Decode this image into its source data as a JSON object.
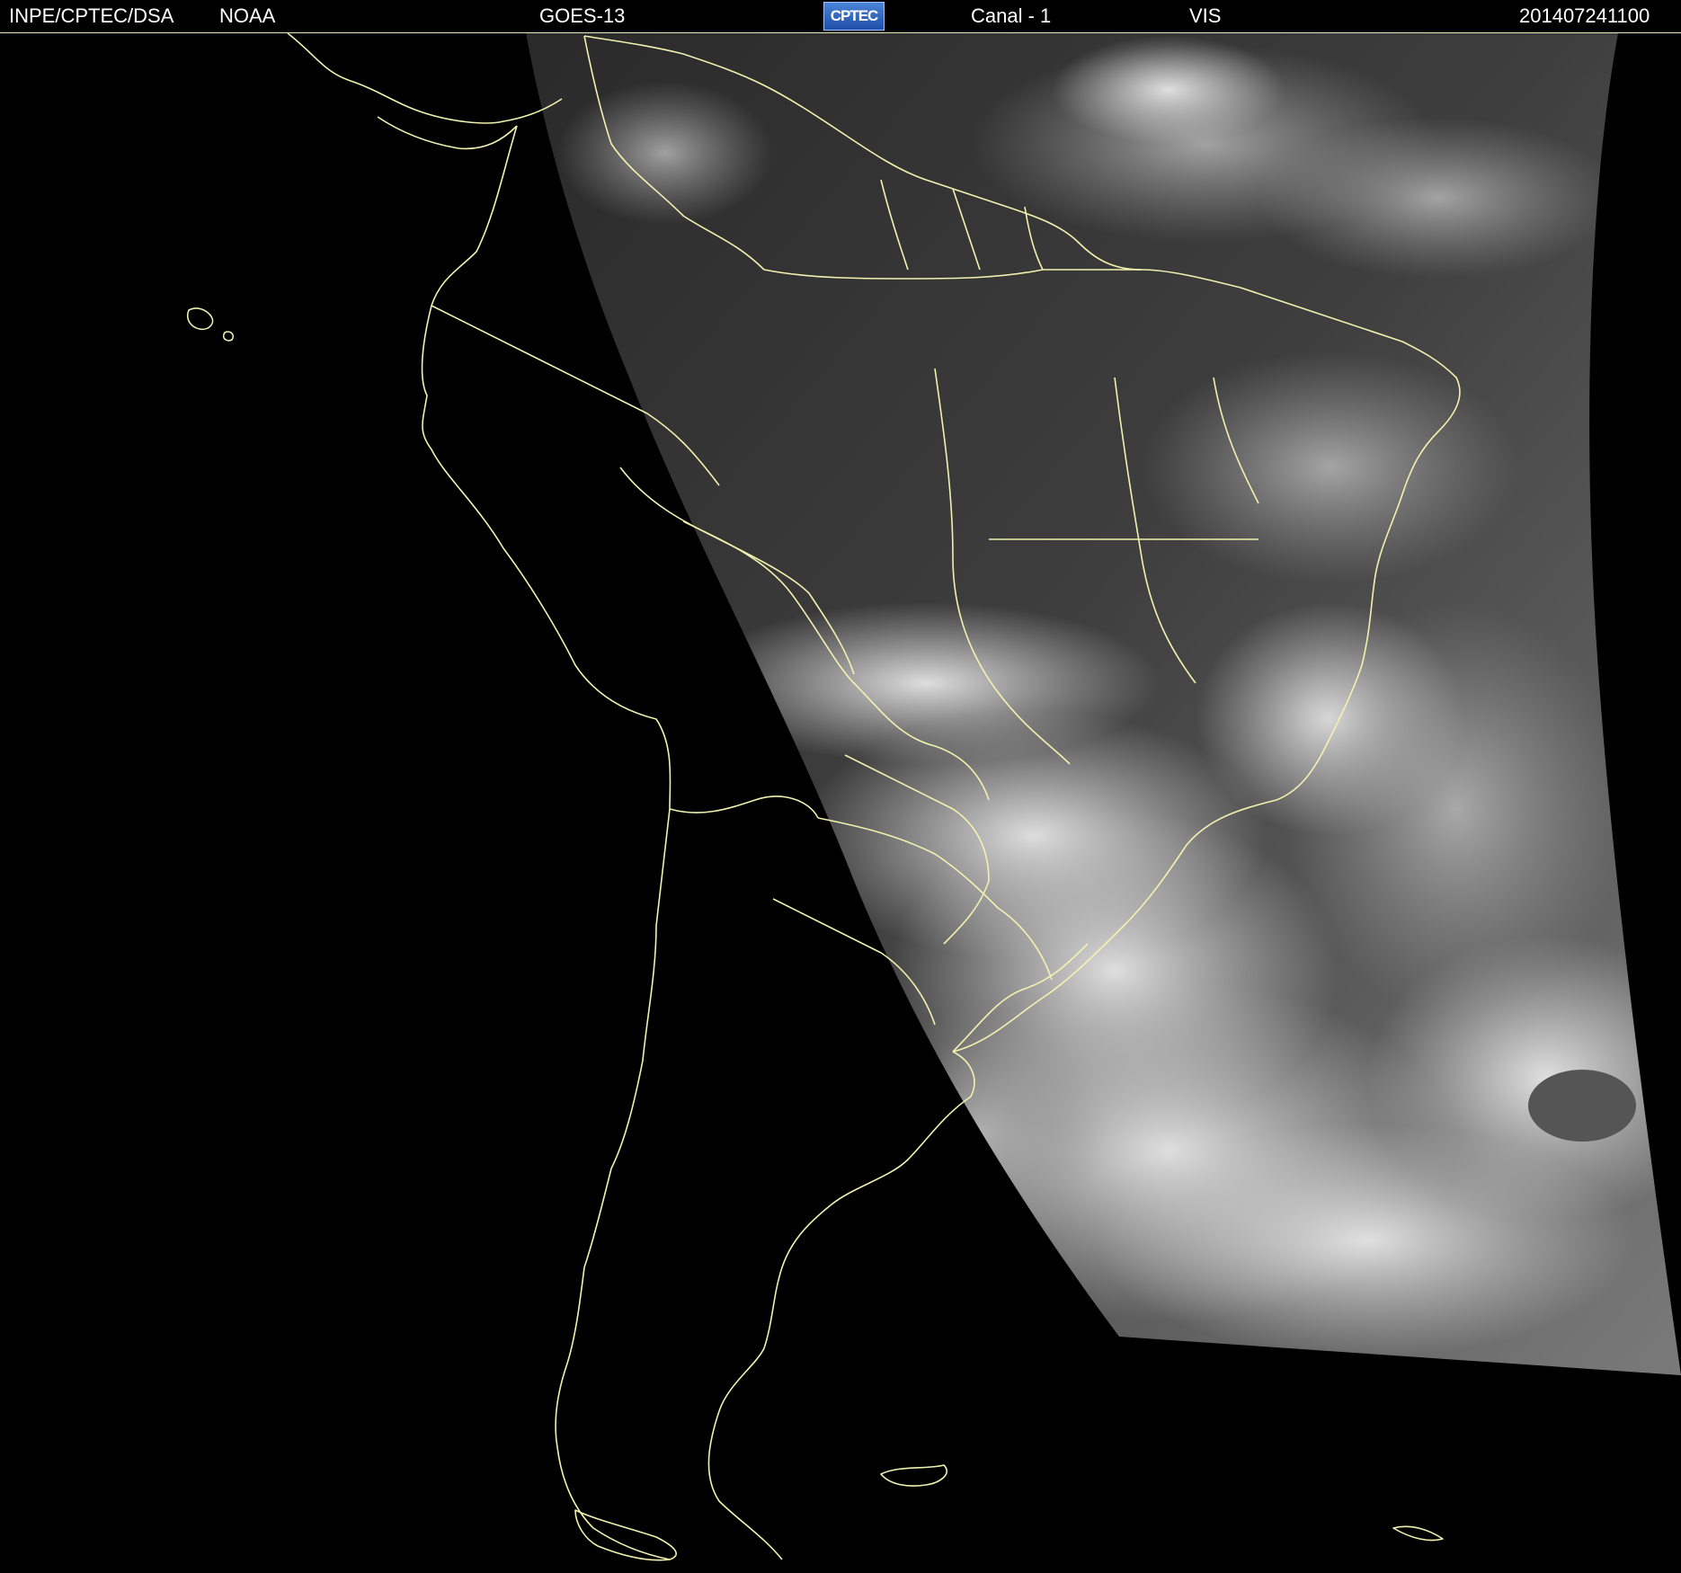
{
  "header": {
    "agency": "INPE/CPTEC/DSA",
    "source": "NOAA",
    "satellite": "GOES-13",
    "logo_text": "CPTEC",
    "channel": "Canal - 1",
    "band": "VIS",
    "timestamp": "201407241100"
  },
  "colors": {
    "background": "#000000",
    "outline": "#f2f2b0",
    "header_text": "#ffffff"
  },
  "icons": {
    "logo": "cptec-logo-icon"
  }
}
